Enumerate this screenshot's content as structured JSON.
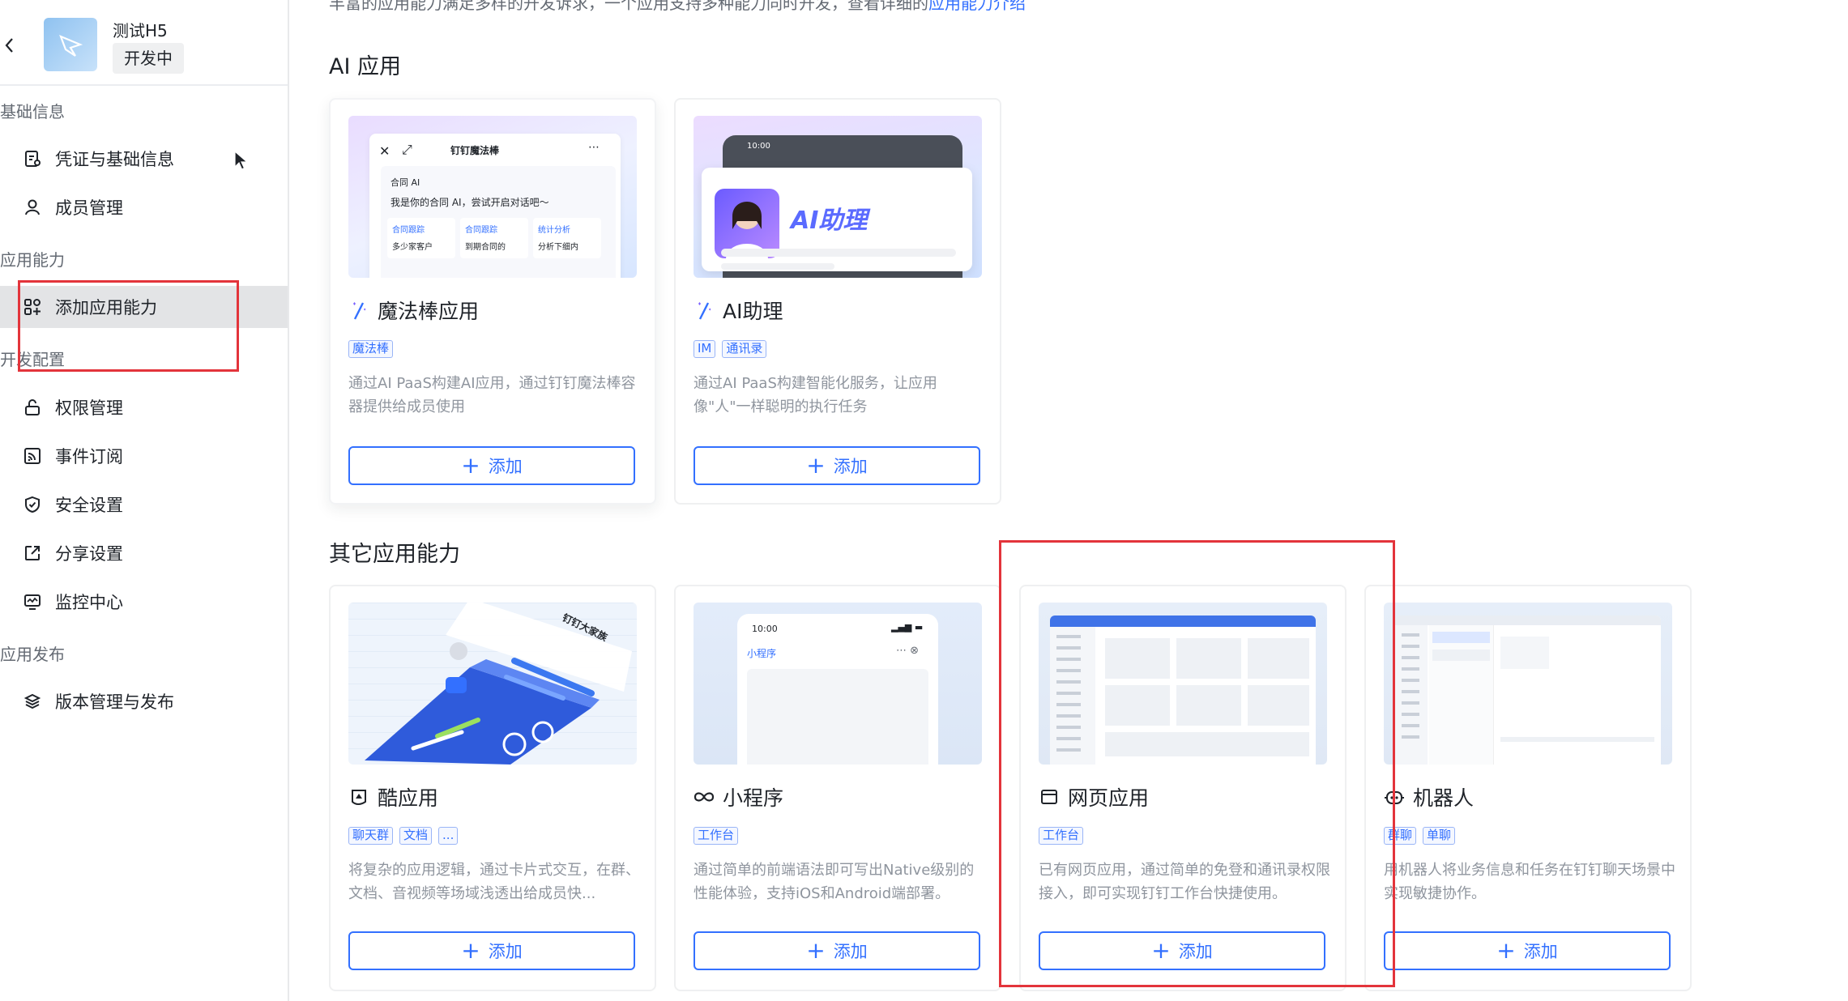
{
  "app": {
    "name": "测试H5",
    "status": "开发中"
  },
  "sidebar": {
    "groups": [
      {
        "title": "基础信息",
        "items": [
          {
            "label": "凭证与基础信息"
          },
          {
            "label": "成员管理"
          }
        ]
      },
      {
        "title": "应用能力",
        "items": [
          {
            "label": "添加应用能力"
          }
        ]
      },
      {
        "title": "开发配置",
        "items": [
          {
            "label": "权限管理"
          },
          {
            "label": "事件订阅"
          },
          {
            "label": "安全设置"
          },
          {
            "label": "分享设置"
          },
          {
            "label": "监控中心"
          }
        ]
      },
      {
        "title": "应用发布",
        "items": [
          {
            "label": "版本管理与发布"
          }
        ]
      }
    ]
  },
  "main": {
    "intro_text": "丰富的应用能力满足多样的开发诉求，一个应用支持多种能力同时开发，查看详细的",
    "intro_link": "应用能力介绍",
    "ai_section": {
      "title": "AI 应用",
      "cards": [
        {
          "title": "魔法棒应用",
          "tags": [
            "魔法棒"
          ],
          "desc": "通过AI PaaS构建AI应用，通过钉钉魔法棒容器提供给成员使用",
          "button": "添加",
          "preview": {
            "header": "钉钉魔法棒",
            "badge": "合同 AI",
            "greeting": "我是你的合同 AI，尝试开启对话吧～",
            "chips": [
              "合同跟踪",
              "合同跟踪",
              "统计分析"
            ],
            "subs": [
              "多少家客户",
              "到期合同的",
              "分析下细内"
            ]
          }
        },
        {
          "title": "AI助理",
          "tags": [
            "IM",
            "通讯录"
          ],
          "desc": "通过AI PaaS构建智能化服务，让应用像\"人\"一样聪明的执行任务",
          "button": "添加",
          "preview": {
            "time": "10:00",
            "label": "AI助理"
          }
        }
      ]
    },
    "other_section": {
      "title": "其它应用能力",
      "cards": [
        {
          "title": "酷应用",
          "tags": [
            "聊天群",
            "文档",
            "..."
          ],
          "desc": "将复杂的应用逻辑，通过卡片式交互，在群、文档、音视频等场域浅透出给成员快...",
          "button": "添加",
          "preview": {
            "label": "钉钉大家族"
          }
        },
        {
          "title": "小程序",
          "tags": [
            "工作台"
          ],
          "desc": "通过简单的前端语法即可写出Native级别的性能体验，支持iOS和Android端部署。",
          "button": "添加",
          "preview": {
            "time": "10:00",
            "label": "小程序"
          }
        },
        {
          "title": "网页应用",
          "tags": [
            "工作台"
          ],
          "desc": "已有网页应用，通过简单的免登和通讯录权限接入，即可实现钉钉工作台快捷使用。",
          "button": "添加"
        },
        {
          "title": "机器人",
          "tags": [
            "群聊",
            "单聊"
          ],
          "desc": "用机器人将业务信息和任务在钉钉聊天场景中实现敏捷协作。",
          "button": "添加"
        }
      ]
    }
  },
  "colors": {
    "accent": "#3370ff",
    "highlight": "#e3343b",
    "active_bg": "#e3e4e6"
  }
}
